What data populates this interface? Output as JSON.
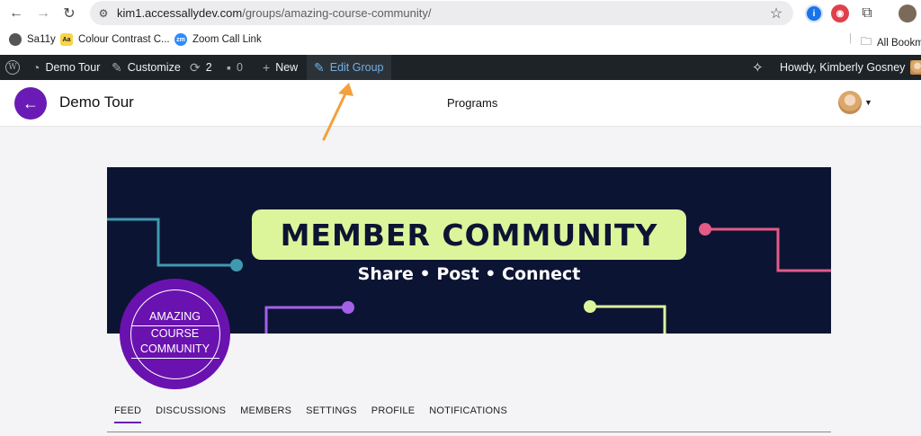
{
  "browser": {
    "url_host": "kim1.accessallydev.com",
    "url_path": "/groups/amazing-course-community/",
    "icons": [
      "back-icon",
      "forward-icon",
      "reload-icon",
      "site-info-icon",
      "star-icon",
      "extension-icon"
    ]
  },
  "bookmarks": {
    "items": [
      {
        "label": "Sa11y",
        "icon": "sa11y-icon"
      },
      {
        "label": "Colour Contrast C...",
        "icon": "contrast-icon",
        "badge": "Aa"
      },
      {
        "label": "Zoom Call Link",
        "icon": "zoom-icon",
        "badge": "zm"
      }
    ],
    "all_label": "All Bookm"
  },
  "adminbar": {
    "site": "Demo Tour",
    "customize": "Customize",
    "updates": "2",
    "comments": "0",
    "new": "New",
    "edit_group": "Edit Group",
    "howdy": "Howdy, Kimberly Gosney"
  },
  "header": {
    "site_title": "Demo Tour",
    "center_title": "Programs"
  },
  "cover": {
    "title": "MEMBER COMMUNITY",
    "tagline": "Share • Post • Connect"
  },
  "group_badge": {
    "line1": "AMAZING",
    "line2": "COURSE",
    "line3": "COMMUNITY"
  },
  "tabs": [
    "FEED",
    "DISCUSSIONS",
    "MEMBERS",
    "SETTINGS",
    "PROFILE",
    "NOTIFICATIONS"
  ],
  "colors": {
    "accent": "#6a1bb5",
    "cover_bg": "#0c1433",
    "pill": "#dcf59b",
    "annotation": "#f3a03d"
  }
}
